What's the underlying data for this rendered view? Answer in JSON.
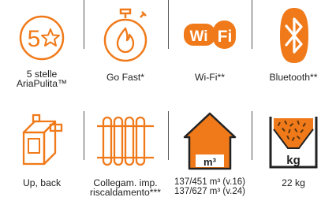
{
  "colors": {
    "accent": "#F07A1A",
    "text": "#222222",
    "divider": "#555555"
  },
  "features": [
    {
      "icon": "five-star-badge-icon",
      "line1": "5 stelle",
      "line2": "AriaPulita™",
      "badge_text": "5"
    },
    {
      "icon": "stopwatch-flame-icon",
      "line1": "Go Fast*",
      "line2": ""
    },
    {
      "icon": "wifi-badge-icon",
      "line1": "Wi-Fi**",
      "line2": "",
      "badge_text": "Wi Fi"
    },
    {
      "icon": "bluetooth-icon",
      "line1": "Bluetooth**",
      "line2": ""
    },
    {
      "icon": "stove-flue-icon",
      "line1": "Up, back",
      "line2": ""
    },
    {
      "icon": "radiator-icon",
      "line1": "Collegam. imp.",
      "line2": "riscaldamento***"
    },
    {
      "icon": "house-volume-icon",
      "line1": "137/451 m³ (v.16)",
      "line2": "137/627 m³ (v.24)",
      "badge_text": "m³"
    },
    {
      "icon": "pellet-hopper-icon",
      "line1": "22 kg",
      "line2": "",
      "badge_text": "kg"
    }
  ]
}
